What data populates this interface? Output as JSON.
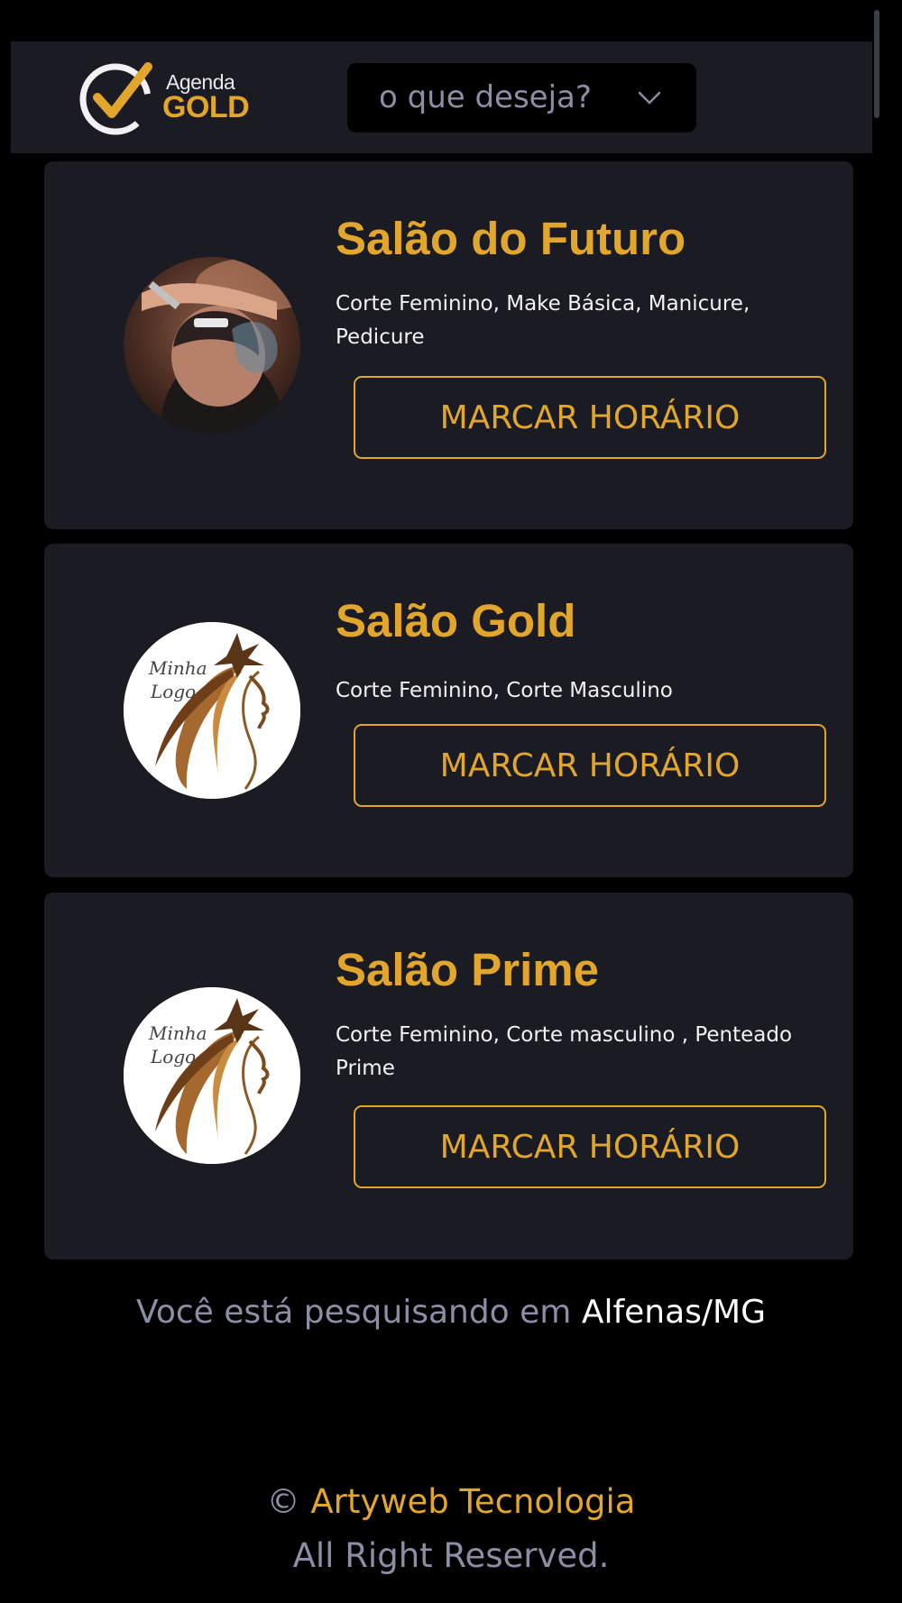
{
  "header": {
    "logo": {
      "agenda": "Agenda",
      "gold": "GOLD"
    },
    "select": {
      "label": "o que deseja?",
      "icon": "chevron-down-icon"
    }
  },
  "salons": [
    {
      "name": "Salão do Futuro",
      "services": "Corte Feminino, Make Básica, Manicure, Pedicure",
      "button": "MARCAR HORÁRIO",
      "avatar": "barber-photo"
    },
    {
      "name": "Salão Gold",
      "services": "Corte Feminino, Corte Masculino",
      "button": "MARCAR HORÁRIO",
      "avatar": "minha-logo",
      "logo_text": "Minha Logo"
    },
    {
      "name": "Salão Prime",
      "services": "Corte Feminino, Corte masculino , Penteado Prime",
      "button": "MARCAR HORÁRIO",
      "avatar": "minha-logo",
      "logo_text": "Minha Logo"
    }
  ],
  "location": {
    "prefix": "Você está pesquisando em",
    "city": "Alfenas/MG"
  },
  "footer": {
    "symbol": "©",
    "company": "Artyweb Tecnologia",
    "rights": "All Right Reserved."
  },
  "colors": {
    "accent": "#e1a62b",
    "card": "#1a1b23",
    "background": "#000000",
    "muted": "#8c8ea6"
  }
}
